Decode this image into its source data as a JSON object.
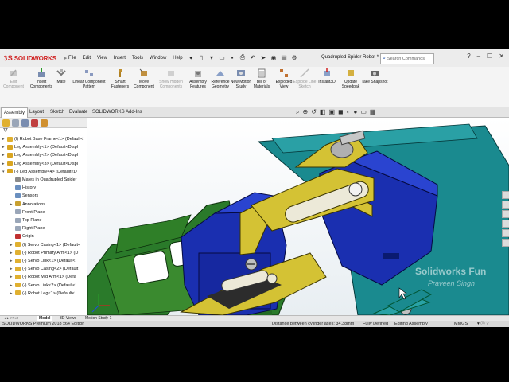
{
  "app": {
    "logo_text": "SOLIDWORKS",
    "menu": [
      "File",
      "Edit",
      "View",
      "Insert",
      "Tools",
      "Window",
      "Help"
    ],
    "document_title": "Quadrupled Spider Robot *",
    "search_placeholder": "Search Commands"
  },
  "commands": [
    {
      "label": "Edit Component",
      "enabled": false
    },
    {
      "label": "Insert Components",
      "enabled": true
    },
    {
      "label": "Mate",
      "enabled": true
    },
    {
      "label": "Linear Component Pattern",
      "enabled": true
    },
    {
      "label": "Smart Fasteners",
      "enabled": true
    },
    {
      "label": "Move Component",
      "enabled": true
    },
    {
      "label": "Show Hidden Components",
      "enabled": false
    },
    {
      "label": "Assembly Features",
      "enabled": true
    },
    {
      "label": "Reference Geometry",
      "enabled": true
    },
    {
      "label": "New Motion Study",
      "enabled": true
    },
    {
      "label": "Bill of Materials",
      "enabled": true
    },
    {
      "label": "Exploded View",
      "enabled": true
    },
    {
      "label": "Explode Line Sketch",
      "enabled": false
    },
    {
      "label": "Instant3D",
      "enabled": true
    },
    {
      "label": "Update Speedpak",
      "enabled": true
    },
    {
      "label": "Take Snapshot",
      "enabled": true
    }
  ],
  "tabs": [
    "Assembly",
    "Layout",
    "Sketch",
    "Evaluate",
    "SOLIDWORKS Add-Ins"
  ],
  "active_tab": "Assembly",
  "tree": [
    {
      "label": "(f) Robot Base Frame<1> (Default<",
      "level": 0,
      "expander": "▸",
      "color": "#e0b030"
    },
    {
      "label": "Leg Assembly<1> (Default<Displ",
      "level": 0,
      "expander": "▸",
      "color": "#d9a520"
    },
    {
      "label": "Leg Assembly<2> (Default<Displ",
      "level": 0,
      "expander": "▸",
      "color": "#d9a520"
    },
    {
      "label": "Leg Assembly<3> (Default<Displ",
      "level": 0,
      "expander": "▸",
      "color": "#d9a520"
    },
    {
      "label": "(-) Leg Assembly<4> (Default<D",
      "level": 0,
      "expander": "▾",
      "color": "#d9a520"
    },
    {
      "label": "Mates in Quadrupled Spider",
      "level": 1,
      "expander": "",
      "color": "#8a8a8a"
    },
    {
      "label": "History",
      "level": 1,
      "expander": "",
      "color": "#6a8fbf"
    },
    {
      "label": "Sensors",
      "level": 1,
      "expander": "",
      "color": "#6a8fbf"
    },
    {
      "label": "Annotations",
      "level": 1,
      "expander": "▸",
      "color": "#c8a030"
    },
    {
      "label": "Front Plane",
      "level": 1,
      "expander": "",
      "color": "#9aa6b8"
    },
    {
      "label": "Top Plane",
      "level": 1,
      "expander": "",
      "color": "#9aa6b8"
    },
    {
      "label": "Right Plane",
      "level": 1,
      "expander": "",
      "color": "#9aa6b8"
    },
    {
      "label": "Origin",
      "level": 1,
      "expander": "",
      "color": "#c03030"
    },
    {
      "label": "(f) Servo Casing<1> (Default<",
      "level": 1,
      "expander": "▸",
      "color": "#e0b030"
    },
    {
      "label": "(-) Robot Primary Arm<1> (D",
      "level": 1,
      "expander": "▸",
      "color": "#e0b030"
    },
    {
      "label": "(-) Servo Link<1> (Default<",
      "level": 1,
      "expander": "▸",
      "color": "#e0b030"
    },
    {
      "label": "(-) Servo Casing<2> (Default",
      "level": 1,
      "expander": "▸",
      "color": "#e0b030"
    },
    {
      "label": "(-) Robot Mid Arm<1> (Defa",
      "level": 1,
      "expander": "▸",
      "color": "#e0b030"
    },
    {
      "label": "(-) Servo Link<2> (Default<",
      "level": 1,
      "expander": "▸",
      "color": "#e0b030"
    },
    {
      "label": "(-) Robot Leg<1> (Default<",
      "level": 1,
      "expander": "▸",
      "color": "#e0b030"
    }
  ],
  "bottom_tabs": [
    "Model",
    "3D Views",
    "Motion Study 1"
  ],
  "active_bottom_tab": "Model",
  "status": {
    "edition": "SOLIDWORKS Premium 2018 x64 Edition",
    "measure": "Distance between cylinder axes: 34.38mm",
    "definition": "Fully Defined",
    "mode": "Editing Assembly",
    "units": "MMGS"
  },
  "watermark": {
    "line1": "Solidworks Fun",
    "line2": "Praveen Singh"
  },
  "colors": {
    "base_frame": "#1a8a8f",
    "leg_green": "#2a7a2a",
    "servo_blue": "#1a2fb0",
    "arm_yellow": "#d4c234",
    "accent_red": "#d02020"
  }
}
